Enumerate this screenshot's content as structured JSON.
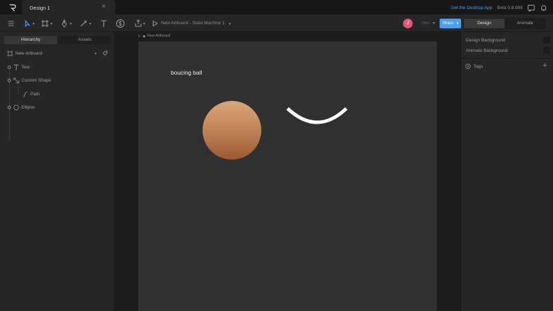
{
  "tabbar": {
    "document_tab": "Design 1",
    "close_glyph": "×",
    "desktop_link": "Get the Desktop App",
    "beta_label": "Beta 0.8.998"
  },
  "toolbar": {
    "state_machine_title": "New Artboard - State Machine 1",
    "avatar_initial": "J",
    "zoom_label": "78%",
    "share_label": "Share",
    "modes": [
      "Design",
      "Animate"
    ],
    "active_mode": "Design",
    "tools": [
      "menu-icon",
      "select-tool-icon",
      "artboard-tool-icon",
      "pen-tool-icon",
      "shape-tool-icon",
      "text-tool-icon",
      "dollar-icon",
      "export-icon",
      "play-icon"
    ]
  },
  "left_panel": {
    "tabs": [
      "Hierarchy",
      "Assets"
    ],
    "active_tab": "Hierarchy",
    "artboard_name": "New Artboard",
    "tree": [
      {
        "label": "Text",
        "icon": "text-icon"
      },
      {
        "label": "Custom Shape",
        "icon": "custom-shape-icon"
      },
      {
        "label": "Path",
        "icon": "path-icon"
      },
      {
        "label": "Ellipse",
        "icon": "ellipse-icon"
      }
    ]
  },
  "canvas": {
    "artboard_label": "New Artboard",
    "text": "boucing ball",
    "ball_colors": [
      "#d8a67a",
      "#c4875a",
      "#9a5a33"
    ],
    "artboard_color": "#303030"
  },
  "right_panel": {
    "design_background": "Design Background",
    "animate_background": "Animate Background",
    "tags_label": "Tags"
  },
  "colors": {
    "accent": "#4a9eeb",
    "avatar": "#e5547a"
  }
}
